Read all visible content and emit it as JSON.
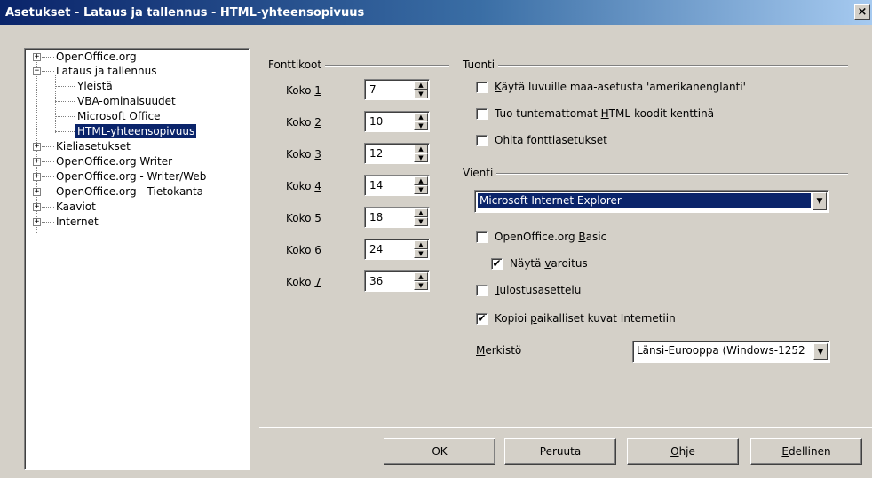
{
  "window": {
    "title": "Asetukset - Lataus ja tallennus - HTML-yhteensopivuus",
    "close_glyph": "×"
  },
  "tree": {
    "items": [
      {
        "label": "OpenOffice.org",
        "expander": "+",
        "level": 0
      },
      {
        "label": "Lataus ja tallennus",
        "expander": "−",
        "level": 0
      },
      {
        "label": "Yleistä",
        "level": 1
      },
      {
        "label": "VBA-ominaisuudet",
        "level": 1
      },
      {
        "label": "Microsoft Office",
        "level": 1
      },
      {
        "label": "HTML-yhteensopivuus",
        "level": 1,
        "selected": true
      },
      {
        "label": "Kieliasetukset",
        "expander": "+",
        "level": 0
      },
      {
        "label": "OpenOffice.org Writer",
        "expander": "+",
        "level": 0
      },
      {
        "label": "OpenOffice.org - Writer/Web",
        "expander": "+",
        "level": 0
      },
      {
        "label": "OpenOffice.org - Tietokanta",
        "expander": "+",
        "level": 0
      },
      {
        "label": "Kaaviot",
        "expander": "+",
        "level": 0
      },
      {
        "label": "Internet",
        "expander": "+",
        "level": 0
      }
    ]
  },
  "font_sizes": {
    "title": "Fonttikoot",
    "rows": [
      {
        "prefix": "Koko ",
        "key": "1",
        "value": "7"
      },
      {
        "prefix": "Koko ",
        "key": "2",
        "value": "10"
      },
      {
        "prefix": "Koko ",
        "key": "3",
        "value": "12"
      },
      {
        "prefix": "Koko ",
        "key": "4",
        "value": "14"
      },
      {
        "prefix": "Koko ",
        "key": "5",
        "value": "18"
      },
      {
        "prefix": "Koko ",
        "key": "6",
        "value": "24"
      },
      {
        "prefix": "Koko ",
        "key": "7",
        "value": "36"
      }
    ]
  },
  "import": {
    "title": "Tuonti",
    "options": [
      {
        "pre": "",
        "key": "K",
        "post": "äytä luvuille maa-asetusta 'amerikanenglanti'",
        "checked": false
      },
      {
        "pre": "Tuo tuntemattomat ",
        "key": "H",
        "post": "TML-koodit kenttinä",
        "checked": false
      },
      {
        "pre": "Ohita ",
        "key": "f",
        "post": "onttiasetukset",
        "checked": false
      }
    ]
  },
  "export": {
    "title": "Vienti",
    "browser": "Microsoft Internet Explorer",
    "basic": {
      "pre": "OpenOffice.org ",
      "key": "B",
      "post": "asic",
      "checked": false
    },
    "warning": {
      "pre": "Näytä ",
      "key": "v",
      "post": "aroitus",
      "checked": true
    },
    "print_layout": {
      "pre": "",
      "key": "T",
      "post": "ulostusasettelu",
      "checked": false
    },
    "copy_images": {
      "pre": "Kopioi ",
      "key": "p",
      "post": "aikalliset kuvat Internetiin",
      "checked": true
    },
    "charset_label_key": "M",
    "charset_label_rest": "erkistö",
    "charset_value": "Länsi-Eurooppa (Windows-1252"
  },
  "buttons": {
    "ok": "OK",
    "cancel": "Peruuta",
    "help_key": "O",
    "help_rest": "hje",
    "back_key": "E",
    "back_rest": "dellinen"
  },
  "glyphs": {
    "check": "✔",
    "spin_up": "▲",
    "spin_down": "▼",
    "dropdown": "▼"
  }
}
